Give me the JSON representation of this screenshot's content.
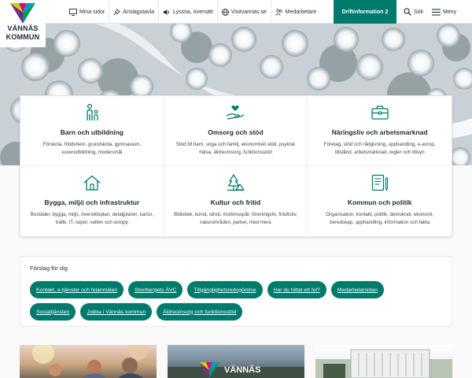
{
  "brand": {
    "logo_line1": "VÄNNÄS",
    "logo_line2": "KOMMUN"
  },
  "nav": {
    "items": [
      {
        "label": "Mina sidor",
        "icon": "monitor-icon"
      },
      {
        "label": "Anslagstavla",
        "icon": "pin-icon"
      },
      {
        "label": "Lyssna, översätt",
        "icon": "speaker-icon"
      },
      {
        "label": "Visitvannas.se",
        "icon": "globe-icon"
      },
      {
        "label": "Medarbetare",
        "icon": "users-icon"
      }
    ],
    "drift_label": "Driftinformation 2",
    "search_label": "Sök",
    "menu_label": "Meny"
  },
  "categories": [
    {
      "title": "Barn och utbildning",
      "desc": "Förskola, fritidshem, grundskola, gymnasium, vuxenutbildning, modersmål",
      "icon": "child-adult-icon"
    },
    {
      "title": "Omsorg och stöd",
      "desc": "Stöd till barn, unga och familj, ekonomiskt stöd, psykisk hälsa, äldreomsorg, funktionsstöd",
      "icon": "hand-heart-icon"
    },
    {
      "title": "Näringsliv och arbetsmarknad",
      "desc": "Företag, stöd och rådgivning, upphandling, e-avrop, tillstånd, arbetsmarknad, regler och tillsyn",
      "icon": "briefcase-icon"
    },
    {
      "title": "Bygga, miljö och infrastruktur",
      "desc": "Bostäder, bygga, miljö, översiktsplan, detaljplaner, kartor, trafik, IT, sopor, vatten och avlopp",
      "icon": "house-icon"
    },
    {
      "title": "Kultur och fritid",
      "desc": "Bibliotek, konst, idrott, motionsspår, föreningsliv, friluftsliv, naturområden, parker, med mera",
      "icon": "tent-tree-icon"
    },
    {
      "title": "Kommun och politik",
      "desc": "Organisation, kontakt, politik, demokrati, ekonomi, beredskap, upphandling, information och fakta",
      "icon": "document-pen-icon"
    }
  ],
  "suggestions": {
    "title": "Förslag för dig",
    "row1": [
      "Kontakt, e-tjänster och felanmälan",
      "Storrbergets ÄVC",
      "Tillgänglighetsredogörelse",
      "Har du hittat ett fel?",
      "Medarbetarsidan"
    ],
    "row2": [
      "Socialtjänsten",
      "Jobba i Vännäs kommun",
      "Äldreomsorg och funktionsstöd"
    ]
  },
  "colors": {
    "accent": "#007a6c",
    "text_dark": "#1f2b3a"
  }
}
